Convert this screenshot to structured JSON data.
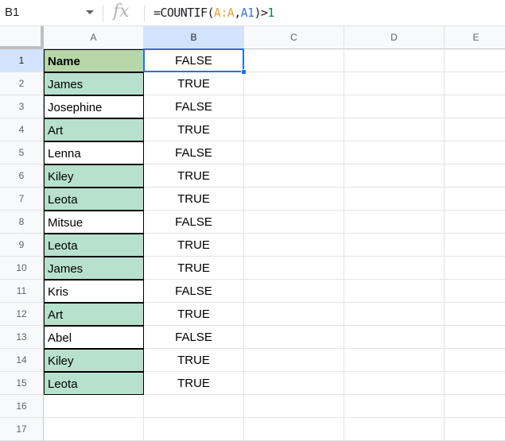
{
  "name_box": {
    "ref": "B1"
  },
  "formula_bar": {
    "fx_label": "fx",
    "parts": {
      "prefix": "=COUNTIF(",
      "range1": "A:A",
      "comma": ",",
      "range2": "A1",
      "suffix": ")>",
      "number": "1"
    }
  },
  "columns": [
    "A",
    "B",
    "C",
    "D",
    "E"
  ],
  "rows": [
    "1",
    "2",
    "3",
    "4",
    "5",
    "6",
    "7",
    "8",
    "9",
    "10",
    "11",
    "12",
    "13",
    "14",
    "15",
    "16",
    "17"
  ],
  "cells": [
    {
      "a": "Name",
      "b": "FALSE",
      "a_style": "header"
    },
    {
      "a": "James",
      "b": "TRUE",
      "a_style": "dup"
    },
    {
      "a": "Josephine",
      "b": "FALSE",
      "a_style": "none"
    },
    {
      "a": "Art",
      "b": "TRUE",
      "a_style": "dup"
    },
    {
      "a": "Lenna",
      "b": "FALSE",
      "a_style": "none"
    },
    {
      "a": "Kiley",
      "b": "TRUE",
      "a_style": "dup"
    },
    {
      "a": "Leota",
      "b": "TRUE",
      "a_style": "dup"
    },
    {
      "a": "Mitsue",
      "b": "FALSE",
      "a_style": "none"
    },
    {
      "a": "Leota",
      "b": "TRUE",
      "a_style": "dup"
    },
    {
      "a": "James",
      "b": "TRUE",
      "a_style": "dup"
    },
    {
      "a": "Kris",
      "b": "FALSE",
      "a_style": "none"
    },
    {
      "a": "Art",
      "b": "TRUE",
      "a_style": "dup"
    },
    {
      "a": "Abel",
      "b": "FALSE",
      "a_style": "none"
    },
    {
      "a": "Kiley",
      "b": "TRUE",
      "a_style": "dup"
    },
    {
      "a": "Leota",
      "b": "TRUE",
      "a_style": "dup"
    },
    {
      "a": "",
      "b": "",
      "a_style": "none"
    },
    {
      "a": "",
      "b": "",
      "a_style": "none"
    }
  ],
  "colors": {
    "duplicate_fill": "#b7e1cd",
    "header_fill": "#b7d7a8",
    "selection": "#1a73e8",
    "range1_ref": "#e8a33c",
    "range2_ref": "#3c78d8"
  },
  "selected_cell": "B1"
}
